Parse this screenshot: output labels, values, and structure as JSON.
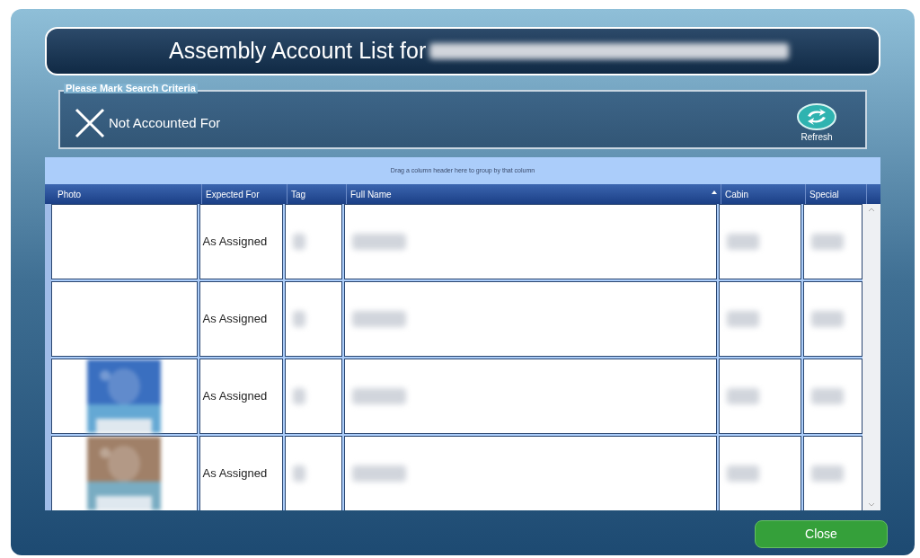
{
  "title": "Assembly Account List for",
  "criteria": {
    "legend": "Please Mark Search Criteria",
    "option": {
      "label": "Not Accounted For",
      "checked": true
    },
    "refresh": "Refresh"
  },
  "grid": {
    "group_hint": "Drag a column header here to group by that column",
    "columns": [
      {
        "label": "Photo",
        "sorted": false
      },
      {
        "label": "Expected For",
        "sorted": false
      },
      {
        "label": "Tag",
        "sorted": false
      },
      {
        "label": "Full Name",
        "sorted": true
      },
      {
        "label": "Cabin",
        "sorted": false
      },
      {
        "label": "Special",
        "sorted": false
      }
    ],
    "rows": [
      {
        "expected_for": "As Assigned",
        "has_photo": false
      },
      {
        "expected_for": "As Assigned",
        "has_photo": false
      },
      {
        "expected_for": "As Assigned",
        "has_photo": true,
        "color": "#3a6fc0"
      },
      {
        "expected_for": "As Assigned",
        "has_photo": true,
        "color": "#a08068"
      }
    ]
  },
  "close": "Close"
}
